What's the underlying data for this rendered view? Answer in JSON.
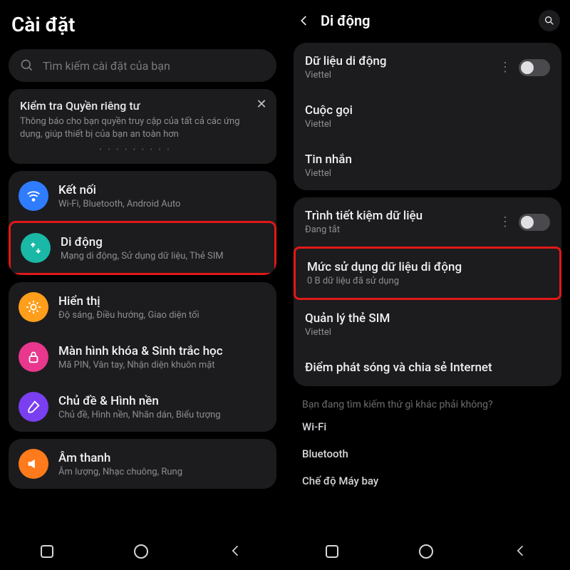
{
  "left": {
    "title": "Cài đặt",
    "search_placeholder": "Tìm kiếm cài đặt của bạn",
    "notice": {
      "title": "Kiểm tra Quyền riêng tư",
      "body": "Thông báo cho bạn quyền truy cập của tất cả các ứng dụng, giúp thiết bị của bạn an toàn hơn"
    },
    "groups": [
      {
        "items": [
          {
            "id": "connections",
            "title": "Kết nối",
            "sub": "Wi-Fi, Bluetooth, Android Auto",
            "color": "c-blue",
            "highlight": false
          },
          {
            "id": "mobile",
            "title": "Di động",
            "sub": "Mạng di động, Sử dụng dữ liệu, Thẻ SIM",
            "color": "c-teal",
            "highlight": true
          }
        ]
      },
      {
        "items": [
          {
            "id": "display",
            "title": "Hiển thị",
            "sub": "Độ sáng, Điều hướng, Giao diện tối",
            "color": "c-orange",
            "highlight": false
          },
          {
            "id": "lock",
            "title": "Màn hình khóa & Sinh trắc học",
            "sub": "Mã PIN, Vân tay, Nhận diện khuôn mặt",
            "color": "c-pink",
            "highlight": false
          },
          {
            "id": "theme",
            "title": "Chủ đề & Hình nền",
            "sub": "Chủ đề, Hình nền, Nhãn dán, Biểu tượng",
            "color": "c-purple",
            "highlight": false
          }
        ]
      },
      {
        "items": [
          {
            "id": "sound",
            "title": "Âm thanh",
            "sub": "Âm lượng, Nhạc chuông, Rung",
            "color": "c-orange2",
            "highlight": false
          }
        ]
      }
    ]
  },
  "right": {
    "title": "Di động",
    "card1": [
      {
        "id": "mobile-data",
        "t": "Dữ liệu di động",
        "s": "Viettel",
        "toggle": true,
        "more": true
      },
      {
        "id": "calls",
        "t": "Cuộc gọi",
        "s": "Viettel"
      },
      {
        "id": "sms",
        "t": "Tin nhắn",
        "s": "Viettel"
      }
    ],
    "card2": [
      {
        "id": "data-saver",
        "t": "Trình tiết kiệm dữ liệu",
        "s": "Đang tắt",
        "toggle": true,
        "more": true
      },
      {
        "id": "data-usage",
        "t": "Mức sử dụng dữ liệu di động",
        "s": "0 B dữ liệu đã sử dụng",
        "highlight": true
      },
      {
        "id": "sim-manage",
        "t": "Quản lý thẻ SIM",
        "s": "Viettel"
      },
      {
        "id": "hotspot",
        "t": "Điểm phát sóng và chia sẻ Internet"
      }
    ],
    "footer": "Bạn đang tìm kiếm thứ gì khác phải không?",
    "links": [
      "Wi-Fi",
      "Bluetooth",
      "Chế độ Máy bay"
    ]
  }
}
